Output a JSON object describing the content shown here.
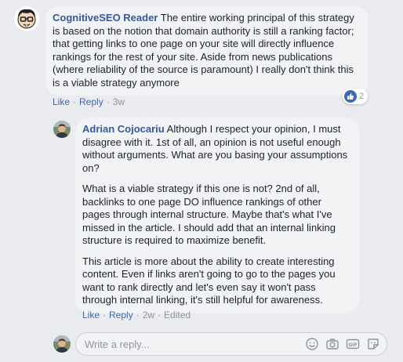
{
  "comments": [
    {
      "author": "CognitiveSEO Reader",
      "paragraphs": [
        "The entire working principal of this strategy is based on the notion that domain authority is still a ranking factor; that getting links to one page on your site will directly influence rankings for the rest of your site. Aside from news publications (where reliability of the source is paramount) I really don't think this is a viable strategy anymore"
      ],
      "actions": {
        "like": "Like",
        "reply": "Reply",
        "time": "3w"
      },
      "reaction": {
        "icon": "thumbs-up-icon",
        "count": "2"
      }
    },
    {
      "author": "Adrian Cojocariu",
      "paragraphs": [
        "Although I respect your opinion, I must disagree with it. 1st of all, an opinion is not useful enough without arguments. What are you basing your assumptions on?",
        "What is a viable strategy if this one is not? 2nd of all, backlinks to one page DO influence rankings of other pages through internal structure. Maybe that's what I've missed in the article. I should add that an internal linking structure is required to maximize benefit.",
        "This article is more about the ability to create interesting content. Even if links aren't going to go to the pages you want to rank directly and let's even say it won't pass through internal linking, it's still helpful for awareness."
      ],
      "actions": {
        "like": "Like",
        "reply": "Reply",
        "time": "2w",
        "edited": "Edited"
      }
    }
  ],
  "reply_box": {
    "placeholder": "Write a reply...",
    "icons": [
      "emoji-icon",
      "camera-icon",
      "gif-icon",
      "sticker-icon"
    ]
  },
  "colors": {
    "background": "#e9ebee",
    "bubble": "#f2f3f5",
    "author": "#385898",
    "link": "#4267b2",
    "meta": "#90949c"
  }
}
